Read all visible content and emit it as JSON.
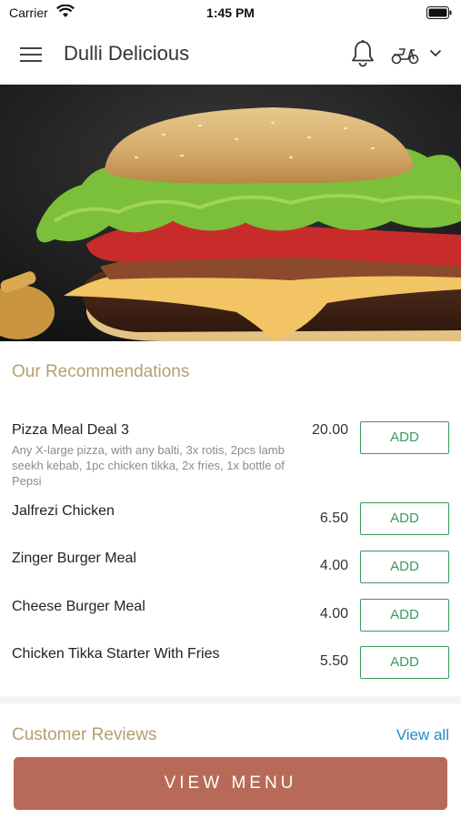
{
  "status_bar": {
    "carrier": "Carrier",
    "time": "1:45 PM"
  },
  "header": {
    "title": "Dulli Delicious"
  },
  "recommendations": {
    "title": "Our Recommendations",
    "items": [
      {
        "name": "Pizza Meal Deal 3",
        "description": "Any X-large pizza, with any balti, 3x rotis, 2pcs lamb seekh kebab, 1pc chicken tikka, 2x fries, 1x bottle of Pepsi",
        "price": "20.00",
        "button": "ADD"
      },
      {
        "name": "Jalfrezi Chicken",
        "description": "",
        "price": "6.50",
        "button": "ADD"
      },
      {
        "name": "Zinger Burger Meal",
        "description": "",
        "price": "4.00",
        "button": "ADD"
      },
      {
        "name": "Cheese Burger Meal",
        "description": "",
        "price": "4.00",
        "button": "ADD"
      },
      {
        "name": "Chicken Tikka Starter With Fries",
        "description": "",
        "price": "5.50",
        "button": "ADD"
      }
    ]
  },
  "reviews": {
    "title": "Customer Reviews",
    "view_all": "View all"
  },
  "footer": {
    "button": "VIEW MENU"
  },
  "colors": {
    "accent_gold": "#b3a071",
    "add_green": "#3b9a5c",
    "menu_button": "#b86a58",
    "link_blue": "#1f8ec9"
  },
  "icons": [
    "wifi-icon",
    "battery-icon",
    "menu-icon",
    "bell-icon",
    "scooter-icon",
    "chevron-down-icon"
  ]
}
